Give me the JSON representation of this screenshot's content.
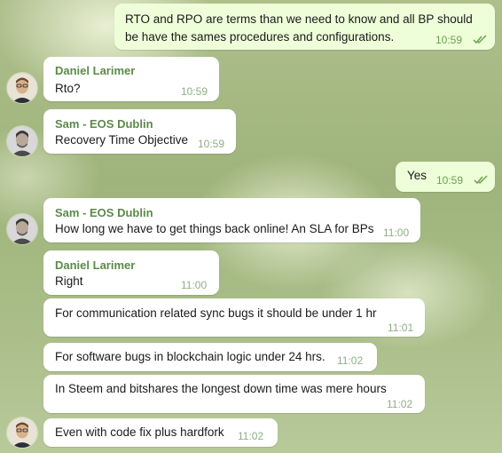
{
  "messages": [
    {
      "line1": "RTO and RPO are terms than we need to know and all BP should",
      "line2": "be have the sames procedures and configurations.",
      "time": "10:59"
    },
    {
      "sender": "Daniel Larimer",
      "text": "Rto?",
      "time": "10:59"
    },
    {
      "sender": "Sam - EOS Dublin",
      "text": "Recovery Time Objective",
      "time": "10:59"
    },
    {
      "text": "Yes",
      "time": "10:59"
    },
    {
      "sender": "Sam - EOS Dublin",
      "text": "How long we have to get things back online! An SLA for BPs",
      "time": "11:00"
    },
    {
      "sender": "Daniel Larimer",
      "text": "Right",
      "time": "11:00"
    },
    {
      "text": "For communication related sync bugs it should be under 1 hr",
      "time": "11:01"
    },
    {
      "text": "For software bugs in blockchain logic under 24 hrs.",
      "time": "11:02"
    },
    {
      "text": "In Steem and bitshares the longest down time was mere hours",
      "time": "11:02"
    },
    {
      "text": "Even with code fix plus hardfork",
      "time": "11:02"
    }
  ],
  "colors": {
    "outgoing_bubble": "#eefed9",
    "incoming_bubble": "#ffffff",
    "sender_name": "#5b8a49",
    "read_check": "#6aa14f"
  },
  "icons": {
    "read_receipt": "double-check-icon"
  }
}
